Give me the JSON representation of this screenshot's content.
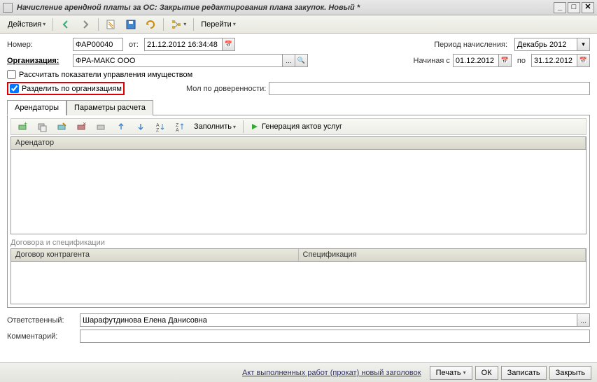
{
  "window": {
    "title": "Начисление арендной платы за ОС: Закрытие редактирования плана закупок. Новый *"
  },
  "toolbar": {
    "actions": "Действия",
    "goto": "Перейти"
  },
  "fields": {
    "number_label": "Номер:",
    "number": "ФАР00040",
    "from_label": "от:",
    "date": "21.12.2012 16:34:48",
    "period_label": "Период начисления:",
    "period": "Декабрь 2012",
    "org_label": "Организация:",
    "org": "ФРА-МАКС ООО",
    "start_label": "Начиная с",
    "start": "01.12.2012",
    "to_label": "по",
    "end": "31.12.2012",
    "chk_calc": "Рассчитать показатели управления имуществом",
    "chk_split": "Разделить по организациям",
    "mol_label": "Мол по доверенности:",
    "mol": "",
    "responsible_label": "Ответственный:",
    "responsible": "Шарафутдинова Елена Данисовна",
    "comment_label": "Комментарий:",
    "comment": ""
  },
  "tabs": {
    "tenants": "Арендаторы",
    "params": "Параметры расчета"
  },
  "subtoolbar": {
    "fill": "Заполнить",
    "generate": "Генерация актов услуг"
  },
  "grids": {
    "tenant_col": "Арендатор",
    "contracts_label": "Договора и спецификации",
    "contract_col": "Договор контрагента",
    "spec_col": "Спецификация"
  },
  "footer": {
    "act_link": "Акт выполненных работ (прокат) новый заголовок",
    "print": "Печать",
    "ok": "ОК",
    "save": "Записать",
    "close": "Закрыть"
  }
}
